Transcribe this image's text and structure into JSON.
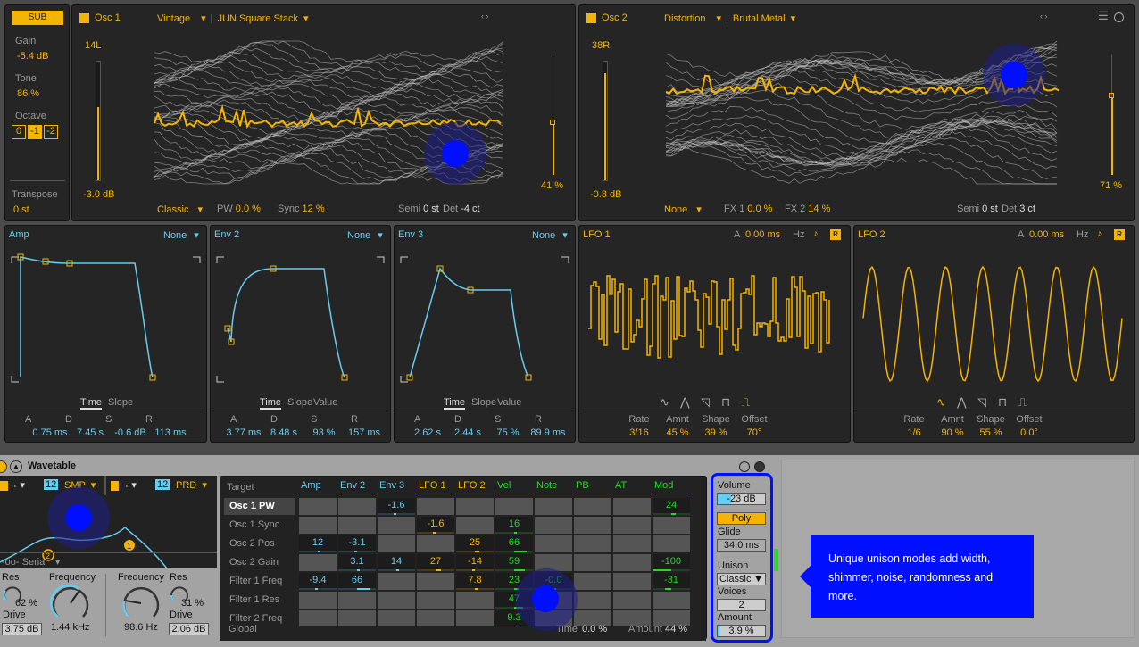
{
  "colors": {
    "accent": "#f5b400",
    "env": "#66ccf0",
    "mod": "#22dd22",
    "annotation": "#0000ff"
  },
  "sub": {
    "button": "SUB",
    "gain_label": "Gain",
    "gain": "-5.4 dB",
    "tone_label": "Tone",
    "tone": "86 %",
    "octave_label": "Octave",
    "octaves": [
      "0",
      "-1",
      "-2"
    ],
    "octave_selected": "-1",
    "transpose_label": "Transpose",
    "transpose": "0 st"
  },
  "osc1": {
    "title": "Osc 1",
    "category": "Vintage",
    "wavetable": "JUN Square Stack",
    "pan": "14L",
    "gain": "-3.0 dB",
    "gain_level": 0.62,
    "position": "41 %",
    "mode": "Classic",
    "p1_label": "PW",
    "p1": "0.0 %",
    "p2_label": "Sync",
    "p2": "12 %",
    "semi_label": "Semi",
    "semi": "0 st",
    "det_label": "Det",
    "det": "-4 ct"
  },
  "osc2": {
    "title": "Osc 2",
    "category": "Distortion",
    "wavetable": "Brutal Metal",
    "pan": "38R",
    "gain": "-0.8 dB",
    "gain_level": 0.9,
    "position": "71 %",
    "mode": "None",
    "p1_label": "FX 1",
    "p1": "0.0 %",
    "p2_label": "FX 2",
    "p2": "14 %",
    "semi_label": "Semi",
    "semi": "0 st",
    "det_label": "Det",
    "det": "3 ct"
  },
  "envs": [
    {
      "title": "Amp",
      "target": "None",
      "tabs": [
        "Time",
        "Slope"
      ],
      "labels": [
        "A",
        "D",
        "S",
        "R"
      ],
      "values": [
        "0.75 ms",
        "7.45 s",
        "-0.6 dB",
        "113 ms"
      ]
    },
    {
      "title": "Env 2",
      "target": "None",
      "tabs": [
        "Time",
        "Slope",
        "Value"
      ],
      "labels": [
        "A",
        "D",
        "S",
        "R"
      ],
      "values": [
        "3.77 ms",
        "8.48 s",
        "93 %",
        "157 ms"
      ]
    },
    {
      "title": "Env 3",
      "target": "None",
      "tabs": [
        "Time",
        "Slope",
        "Value"
      ],
      "labels": [
        "A",
        "D",
        "S",
        "R"
      ],
      "values": [
        "2.62 s",
        "2.44 s",
        "75 %",
        "89.9 ms"
      ]
    }
  ],
  "lfos": [
    {
      "title": "LFO 1",
      "a_label": "A",
      "attack": "0.00 ms",
      "hz": "Hz",
      "sync_icon": "note-icon",
      "retrig": "R",
      "shape_selected": "sample-hold",
      "labels": [
        "Rate",
        "Amnt",
        "Shape",
        "Offset"
      ],
      "values": [
        "3/16",
        "45 %",
        "39 %",
        "70°"
      ]
    },
    {
      "title": "LFO 2",
      "a_label": "A",
      "attack": "0.00 ms",
      "hz": "Hz",
      "sync_icon": "note-icon",
      "retrig": "R",
      "shape_selected": "sine",
      "labels": [
        "Rate",
        "Amnt",
        "Shape",
        "Offset"
      ],
      "values": [
        "1/6",
        "90 %",
        "55 %",
        "0.0°"
      ]
    }
  ],
  "device": {
    "title": "Wavetable"
  },
  "filter": {
    "f1_num": "12",
    "f1_type": "SMP",
    "f2_num": "12",
    "f2_type": "PRD",
    "routing": "Serial",
    "res1_label": "Res",
    "res1": "62 %",
    "freq1_label": "Frequency",
    "freq1": "1.44 kHz",
    "drive1_label": "Drive",
    "drive1": "3.75 dB",
    "freq2_label": "Frequency",
    "freq2": "98.6 Hz",
    "res2_label": "Res",
    "res2": "31 %",
    "drive2_label": "Drive",
    "drive2": "2.06 dB"
  },
  "matrix": {
    "target_label": "Target",
    "columns": [
      "Amp",
      "Env 2",
      "Env 3",
      "LFO 1",
      "LFO 2",
      "Vel",
      "Note",
      "PB",
      "AT",
      "Mod"
    ],
    "rows": [
      {
        "name": "Osc 1 PW",
        "cells": [
          null,
          null,
          "-1.6",
          null,
          null,
          null,
          null,
          null,
          null,
          "24"
        ]
      },
      {
        "name": "Osc 1 Sync",
        "cells": [
          null,
          null,
          null,
          "-1.6",
          null,
          "16",
          null,
          null,
          null,
          null
        ]
      },
      {
        "name": "Osc 2 Pos",
        "cells": [
          "12",
          "-3.1",
          null,
          null,
          "25",
          "66",
          null,
          null,
          null,
          null
        ]
      },
      {
        "name": "Osc 2 Gain",
        "cells": [
          null,
          "3.1",
          "14",
          "27",
          "-14",
          "59",
          null,
          null,
          null,
          "-100"
        ]
      },
      {
        "name": "Filter 1 Freq",
        "cells": [
          "-9.4",
          "66",
          null,
          null,
          "7.8",
          "23",
          "-0.0",
          null,
          null,
          "-31"
        ]
      },
      {
        "name": "Filter 1 Res",
        "cells": [
          null,
          null,
          null,
          null,
          null,
          "47",
          null,
          null,
          null,
          null
        ]
      },
      {
        "name": "Filter 2 Freq",
        "cells": [
          null,
          null,
          null,
          null,
          null,
          "9.3",
          null,
          null,
          null,
          null
        ]
      }
    ],
    "global_label": "Global",
    "time_label": "Time",
    "time": "0.0 %",
    "amount_label": "Amount",
    "amount": "44 %"
  },
  "voice": {
    "volume_label": "Volume",
    "volume": "-23 dB",
    "poly": "Poly",
    "glide_label": "Glide",
    "glide": "34.0 ms",
    "unison_label": "Unison",
    "unison": "Classic",
    "voices_label": "Voices",
    "voices": "2",
    "amount_label": "Amount",
    "amount": "3.9 %"
  },
  "tooltip": "Unique unison modes add width, shimmer, noise, randomness and more."
}
